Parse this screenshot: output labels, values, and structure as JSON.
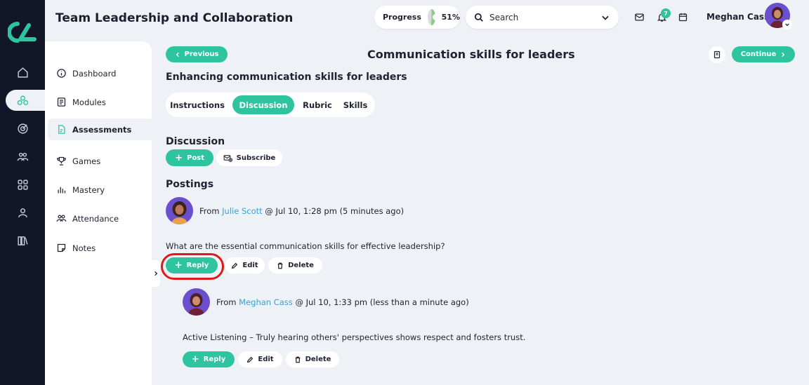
{
  "header": {
    "title": "Team Leadership and Collaboration",
    "progress_label": "Progress",
    "progress_value": "51%",
    "progress_fraction": 0.51,
    "search_placeholder": "Search",
    "notification_count": "7",
    "user_name": "Meghan Cass"
  },
  "rail": {
    "icons": [
      "home-icon",
      "assessments-icon",
      "target-icon",
      "people-icon",
      "apps-icon",
      "profile-icon",
      "library-icon"
    ]
  },
  "sidenav": {
    "items": [
      {
        "label": "Dashboard",
        "icon": "info-icon"
      },
      {
        "label": "Modules",
        "icon": "list-icon"
      },
      {
        "label": "Assessments",
        "icon": "document-icon",
        "active": true
      },
      {
        "label": "Games",
        "icon": "trophy-icon"
      },
      {
        "label": "Mastery",
        "icon": "bar-chart-icon"
      },
      {
        "label": "Attendance",
        "icon": "users-icon"
      },
      {
        "label": "Notes",
        "icon": "note-icon"
      }
    ]
  },
  "main": {
    "previous_label": "Previous",
    "continue_label": "Continue",
    "page_title": "Communication skills for leaders",
    "subtitle": "Enhancing communication skills for leaders",
    "tabs": [
      {
        "label": "Instructions"
      },
      {
        "label": "Discussion",
        "active": true
      },
      {
        "label": "Rubric"
      },
      {
        "label": "Skills"
      }
    ],
    "discussion_heading": "Discussion",
    "post_label": "Post",
    "subscribe_label": "Subscribe",
    "postings_heading": "Postings",
    "posts": [
      {
        "from_prefix": "From",
        "author": "Julie Scott",
        "meta": "@ Jul 10, 1:28 pm (5 minutes ago)",
        "message": "What are the essential communication skills for effective leadership?",
        "reply_label": "Reply",
        "edit_label": "Edit",
        "delete_label": "Delete"
      },
      {
        "from_prefix": "From",
        "author": "Meghan Cass",
        "meta": "@ Jul 10, 1:33 pm (less than a minute ago)",
        "message": "Active Listening – Truly hearing others' perspectives shows respect and fosters trust.",
        "reply_label": "Reply",
        "edit_label": "Edit",
        "delete_label": "Delete"
      }
    ]
  },
  "colors": {
    "accent": "#2ec4a0",
    "rail": "#111728",
    "background": "#eef1f6",
    "link": "#3aa0d8",
    "highlight_ring": "#e01818"
  }
}
